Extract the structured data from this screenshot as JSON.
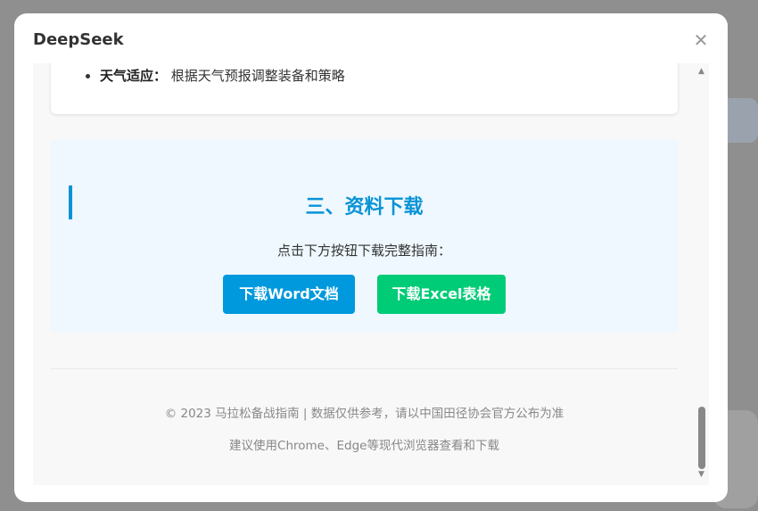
{
  "dialog": {
    "title": "DeepSeek",
    "close_icon": "close-icon"
  },
  "content": {
    "list_item": {
      "label": "天气适应：",
      "text": "根据天气预报调整装备和策略"
    },
    "download": {
      "title": "三、资料下载",
      "subtitle": "点击下方按钮下载完整指南：",
      "word_button": "下载Word文档",
      "excel_button": "下载Excel表格",
      "colors": {
        "accent": "#0a93d6",
        "word": "#0099dd",
        "excel": "#00cc77"
      }
    },
    "footer": {
      "line1": "© 2023 马拉松备战指南 | 数据仅供参考，请以中国田径协会官方公布为准",
      "line2": "建议使用Chrome、Edge等现代浏览器查看和下载"
    }
  }
}
